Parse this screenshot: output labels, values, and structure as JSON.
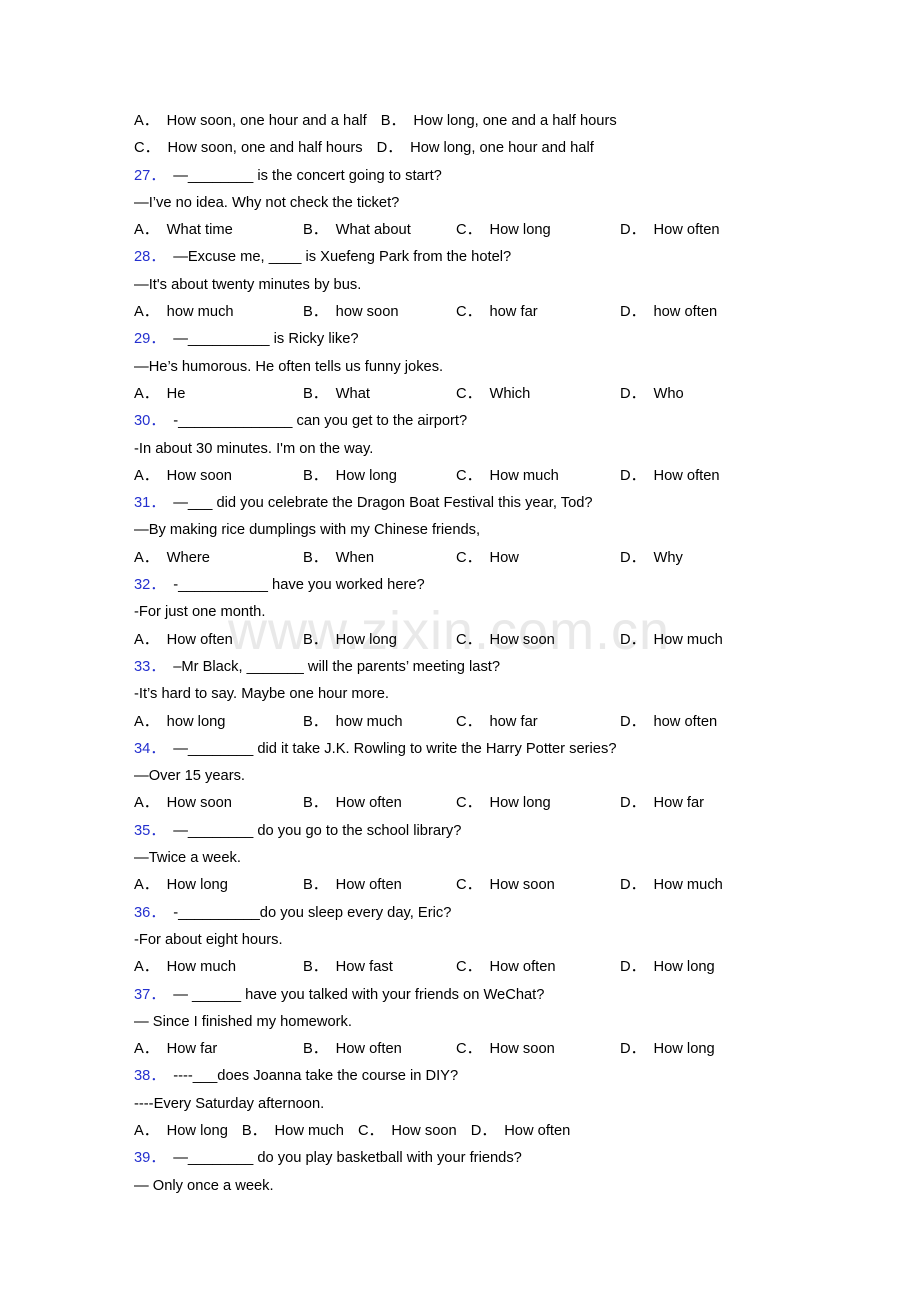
{
  "watermark": {
    "text": "www.zixin.com.cn"
  },
  "accent": {
    "question_number_color": "#2430cf",
    "text_color": "#000000",
    "watermark_color": "#e9e9e9"
  },
  "lines": [
    {
      "kind": "options_inline",
      "name": "options-row-q26",
      "items": [
        {
          "letter": "A．",
          "label": "How soon, one hour and a half"
        },
        {
          "letter": "B．",
          "label": "How long, one and a half hours"
        }
      ]
    },
    {
      "kind": "options_inline",
      "name": "options-row-q26-cd",
      "items": [
        {
          "letter": "C．",
          "label": "How soon, one and half hours"
        },
        {
          "letter": "D．",
          "label": "How long, one hour and half"
        }
      ]
    },
    {
      "kind": "question",
      "name": "question-27",
      "number": "27．",
      "text": "—________ is the concert going to start?"
    },
    {
      "kind": "answer",
      "name": "answer-27",
      "text": "—I’ve no idea. Why not check the ticket?"
    },
    {
      "kind": "options",
      "name": "options-row-27",
      "items": [
        {
          "letter": "A．",
          "label": "What time"
        },
        {
          "letter": "B．",
          "label": "What about"
        },
        {
          "letter": "C．",
          "label": "How long"
        },
        {
          "letter": "D．",
          "label": "How often"
        }
      ]
    },
    {
      "kind": "question",
      "name": "question-28",
      "number": "28．",
      "text": "—Excuse me, ____ is Xuefeng Park from the hotel?"
    },
    {
      "kind": "answer",
      "name": "answer-28",
      "text": "—It's about twenty minutes by bus."
    },
    {
      "kind": "options",
      "name": "options-row-28",
      "items": [
        {
          "letter": "A．",
          "label": "how much"
        },
        {
          "letter": "B．",
          "label": "how soon"
        },
        {
          "letter": "C．",
          "label": "how far"
        },
        {
          "letter": "D．",
          "label": "how often"
        }
      ]
    },
    {
      "kind": "question",
      "name": "question-29",
      "number": "29．",
      "text": "—__________ is Ricky like?"
    },
    {
      "kind": "answer",
      "name": "answer-29",
      "text": "—He’s humorous. He often tells us funny jokes."
    },
    {
      "kind": "options",
      "name": "options-row-29",
      "items": [
        {
          "letter": "A．",
          "label": "He"
        },
        {
          "letter": "B．",
          "label": "What"
        },
        {
          "letter": "C．",
          "label": "Which"
        },
        {
          "letter": "D．",
          "label": "Who"
        }
      ]
    },
    {
      "kind": "question",
      "name": "question-30",
      "number": "30．",
      "text": "-______________ can you get to the airport?"
    },
    {
      "kind": "answer",
      "name": "answer-30",
      "text": "-In about 30 minutes. I'm on the way."
    },
    {
      "kind": "options",
      "name": "options-row-30",
      "items": [
        {
          "letter": "A．",
          "label": "How soon"
        },
        {
          "letter": "B．",
          "label": "How long"
        },
        {
          "letter": "C．",
          "label": "How much"
        },
        {
          "letter": "D．",
          "label": "How often"
        }
      ]
    },
    {
      "kind": "question",
      "name": "question-31",
      "number": "31．",
      "text": "—___ did you celebrate the Dragon Boat Festival this year, Tod?"
    },
    {
      "kind": "answer",
      "name": "answer-31",
      "text": "—By making rice dumplings with my Chinese friends,"
    },
    {
      "kind": "options",
      "name": "options-row-31",
      "items": [
        {
          "letter": "A．",
          "label": "Where"
        },
        {
          "letter": "B．",
          "label": "When"
        },
        {
          "letter": "C．",
          "label": "How"
        },
        {
          "letter": "D．",
          "label": "Why"
        }
      ]
    },
    {
      "kind": "question",
      "name": "question-32",
      "number": "32．",
      "text": "-___________ have you worked here?"
    },
    {
      "kind": "answer",
      "name": "answer-32",
      "text": "-For just one month."
    },
    {
      "kind": "options",
      "name": "options-row-32",
      "items": [
        {
          "letter": "A．",
          "label": "How often"
        },
        {
          "letter": "B．",
          "label": "How long"
        },
        {
          "letter": "C．",
          "label": "How soon"
        },
        {
          "letter": "D．",
          "label": "How much"
        }
      ]
    },
    {
      "kind": "question",
      "name": "question-33",
      "number": "33．",
      "text": "–Mr Black, _______ will the parents’ meeting last?"
    },
    {
      "kind": "answer",
      "name": "answer-33",
      "text": "-It’s hard to say. Maybe one hour more."
    },
    {
      "kind": "options",
      "name": "options-row-33",
      "items": [
        {
          "letter": "A．",
          "label": "how long"
        },
        {
          "letter": "B．",
          "label": "how much"
        },
        {
          "letter": "C．",
          "label": "how far"
        },
        {
          "letter": "D．",
          "label": "how often"
        }
      ]
    },
    {
      "kind": "question",
      "name": "question-34",
      "number": "34．",
      "text": "—________ did it take J.K. Rowling to write the Harry Potter series?"
    },
    {
      "kind": "answer",
      "name": "answer-34",
      "text": "—Over 15 years."
    },
    {
      "kind": "options",
      "name": "options-row-34",
      "items": [
        {
          "letter": "A．",
          "label": "How soon"
        },
        {
          "letter": "B．",
          "label": "How often"
        },
        {
          "letter": "C．",
          "label": "How long"
        },
        {
          "letter": "D．",
          "label": "How far"
        }
      ]
    },
    {
      "kind": "question",
      "name": "question-35",
      "number": "35．",
      "text": "—________ do you go to the school library?"
    },
    {
      "kind": "answer",
      "name": "answer-35",
      "text": "—Twice a week."
    },
    {
      "kind": "options",
      "name": "options-row-35",
      "items": [
        {
          "letter": "A．",
          "label": "How long"
        },
        {
          "letter": "B．",
          "label": "How often"
        },
        {
          "letter": "C．",
          "label": "How soon"
        },
        {
          "letter": "D．",
          "label": "How much"
        }
      ]
    },
    {
      "kind": "question",
      "name": "question-36",
      "number": "36．",
      "text": "-__________do you sleep every day, Eric?"
    },
    {
      "kind": "answer",
      "name": "answer-36",
      "text": "-For about eight hours."
    },
    {
      "kind": "options",
      "name": "options-row-36",
      "items": [
        {
          "letter": "A．",
          "label": "How much"
        },
        {
          "letter": "B．",
          "label": "How fast"
        },
        {
          "letter": "C．",
          "label": "How often"
        },
        {
          "letter": "D．",
          "label": "How long"
        }
      ]
    },
    {
      "kind": "question",
      "name": "question-37",
      "number": "37．",
      "text": "— ______ have you talked with your friends on WeChat?"
    },
    {
      "kind": "answer",
      "name": "answer-37",
      "text": "— Since I finished my homework."
    },
    {
      "kind": "options",
      "name": "options-row-37",
      "items": [
        {
          "letter": "A．",
          "label": "How far"
        },
        {
          "letter": "B．",
          "label": "How often"
        },
        {
          "letter": "C．",
          "label": "How soon"
        },
        {
          "letter": "D．",
          "label": "How long"
        }
      ]
    },
    {
      "kind": "question",
      "name": "question-38",
      "number": "38．",
      "text": "----___does Joanna take the course in DIY?"
    },
    {
      "kind": "answer",
      "name": "answer-38",
      "text": "----Every Saturday afternoon."
    },
    {
      "kind": "options_inline",
      "name": "options-row-38",
      "items": [
        {
          "letter": "A．",
          "label": "How long"
        },
        {
          "letter": "B．",
          "label": "How much"
        },
        {
          "letter": "C．",
          "label": "How soon"
        },
        {
          "letter": "D．",
          "label": "How often"
        }
      ]
    },
    {
      "kind": "question",
      "name": "question-39",
      "number": "39．",
      "text": "—________ do you play basketball with your friends?"
    },
    {
      "kind": "answer",
      "name": "answer-39",
      "text": "— Only once a week."
    }
  ]
}
